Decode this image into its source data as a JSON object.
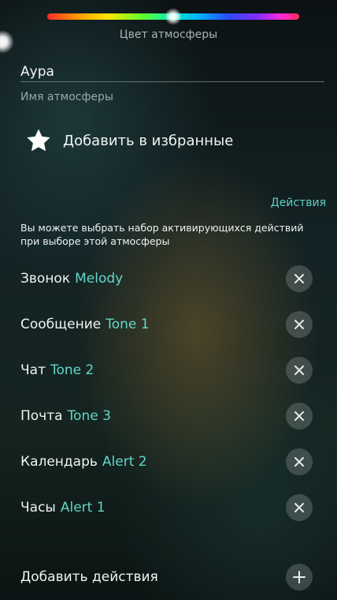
{
  "atmosphere": {
    "color_label": "Цвет атмосферы",
    "name_value": "Аура",
    "name_hint": "Имя атмосферы",
    "spectrum_position": 0.5
  },
  "favorites": {
    "label": "Добавить в избранные",
    "icon": "star-icon"
  },
  "actions": {
    "header": "Действия",
    "description": "Вы можете выбрать набор активирующихся действий при выборе этой атмосферы",
    "items": [
      {
        "name": "Звонок",
        "tone": "Melody"
      },
      {
        "name": "Сообщение",
        "tone": "Tone 1"
      },
      {
        "name": "Чат",
        "tone": "Tone 2"
      },
      {
        "name": "Почта",
        "tone": "Tone 3"
      },
      {
        "name": "Календарь",
        "tone": "Alert 2"
      },
      {
        "name": "Часы",
        "tone": "Alert 1"
      }
    ],
    "remove_icon": "close-icon",
    "add_label": "Добавить действия",
    "add_icon": "plus-icon"
  },
  "colors": {
    "accent": "#5fd3c4",
    "text": "#f0f3f3",
    "muted": "#9aa7a8"
  }
}
